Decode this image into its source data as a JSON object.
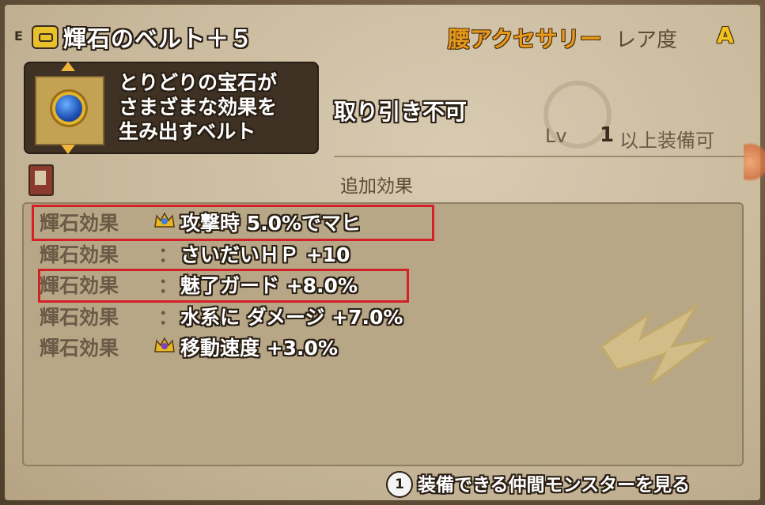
{
  "header": {
    "equip_mark": "E",
    "item_name": "輝石のベルト＋５",
    "category": "腰アクセサリー",
    "rarity_label": "レア度",
    "rarity_value": "A"
  },
  "description": {
    "lines": [
      "とりどりの宝石が",
      "さまざまな効果を",
      "生み出すベルト"
    ]
  },
  "trade_status": "取り引き不可",
  "level": {
    "label": "Lv",
    "value": "1",
    "suffix": "以上装備可"
  },
  "effects": {
    "title": "追加効果",
    "rows": [
      {
        "label": "輝石効果",
        "separator": "",
        "value": "攻撃時 5.0%でマヒ",
        "crown": true,
        "highlighted": true
      },
      {
        "label": "輝石効果",
        "separator": "：",
        "value": "さいだいＨＰ +10",
        "crown": false,
        "highlighted": false
      },
      {
        "label": "輝石効果",
        "separator": "：",
        "value": "魅了ガード +8.0%",
        "crown": false,
        "highlighted": true
      },
      {
        "label": "輝石効果",
        "separator": "：",
        "value": "水系に ダメージ +7.0%",
        "crown": false,
        "highlighted": false
      },
      {
        "label": "輝石効果",
        "separator": "",
        "value": "移動速度 +3.0%",
        "crown": true,
        "highlighted": false
      }
    ]
  },
  "footer": {
    "button": "1",
    "text": "装備できる仲間モンスターを見る"
  },
  "colors": {
    "highlight_border": "#d42027",
    "category": "#e6981a",
    "rarity": "#f2c31c"
  },
  "icons": [
    "belt-icon",
    "book-icon",
    "crown-icon",
    "gem-icon"
  ]
}
